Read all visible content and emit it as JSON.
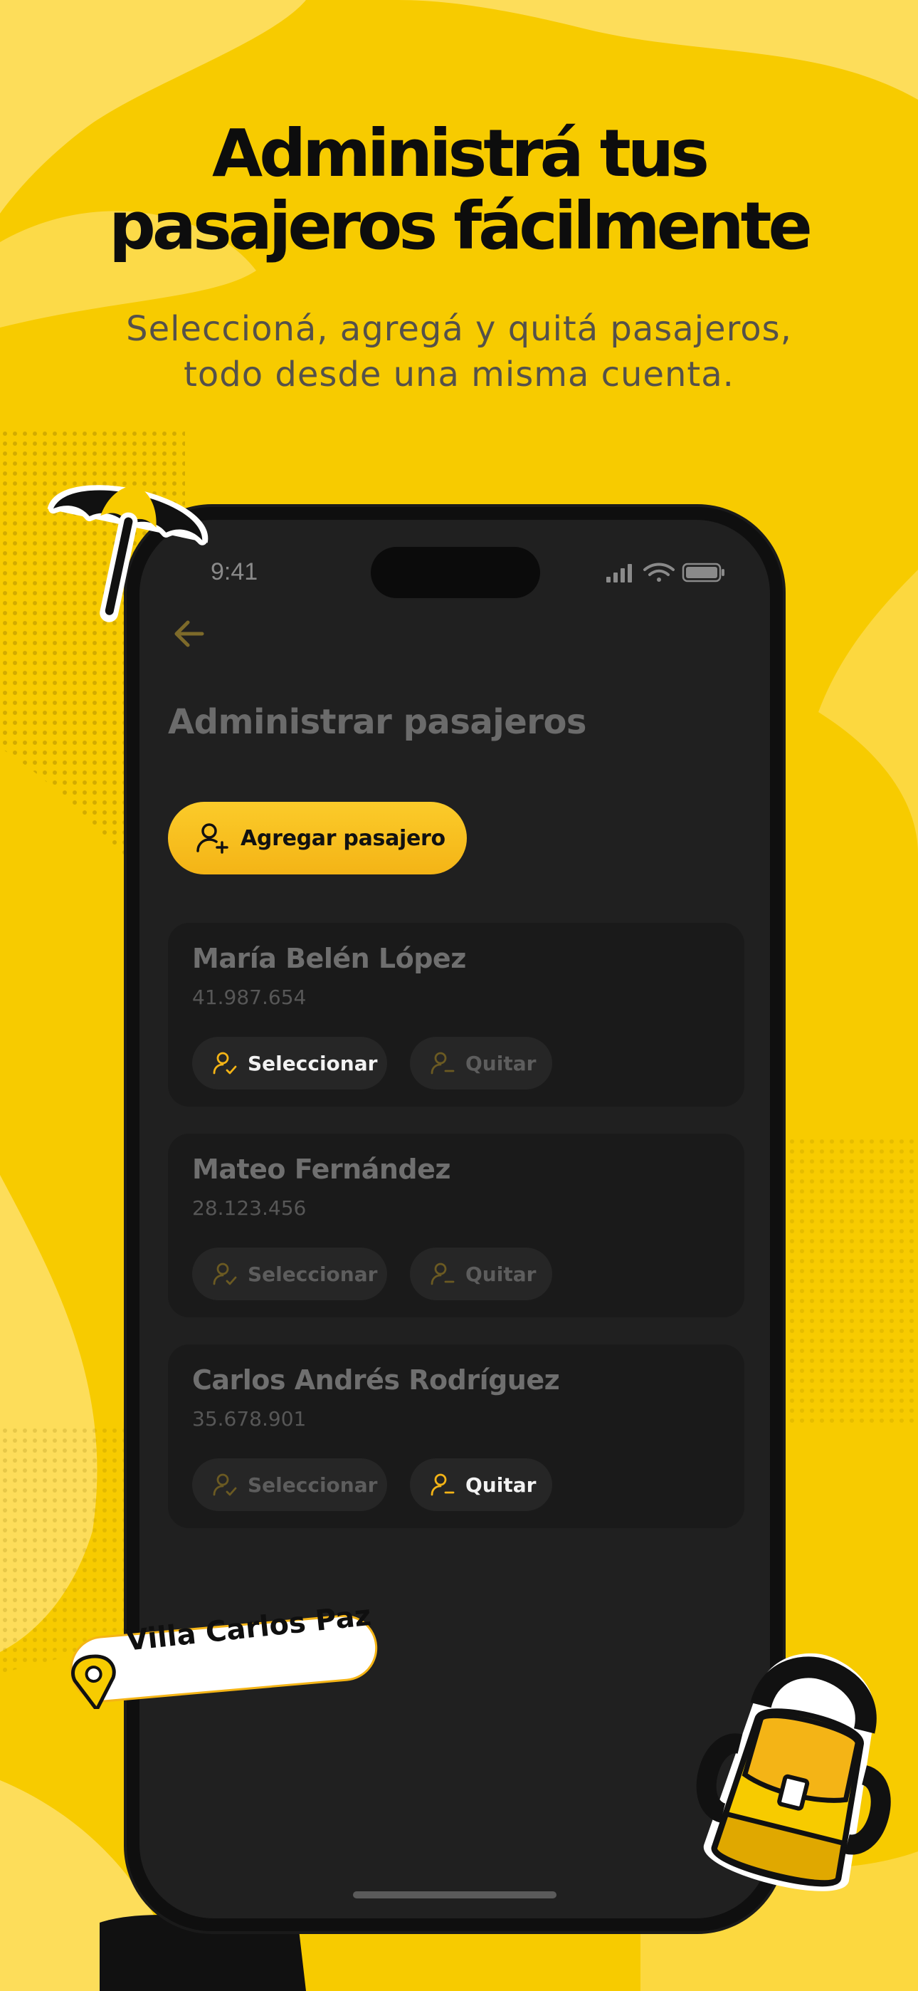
{
  "headline": {
    "line1": "Administrá tus",
    "line2": "pasajeros fácilmente"
  },
  "subheadline": "Seleccioná, agregá y quitá pasajeros, todo desde una misma cuenta.",
  "status_bar": {
    "time": "9:41"
  },
  "screen": {
    "title": "Administrar pasajeros",
    "add_button_label": "Agregar pasajero"
  },
  "passengers": [
    {
      "name": "María Belén López",
      "id_number": "41.987.654",
      "select_label": "Seleccionar",
      "remove_label": "Quitar",
      "active_action": "select"
    },
    {
      "name": "Mateo Fernández",
      "id_number": "28.123.456",
      "select_label": "Seleccionar",
      "remove_label": "Quitar",
      "active_action": "none"
    },
    {
      "name": "Carlos Andrés Rodríguez",
      "id_number": "35.678.901",
      "select_label": "Seleccionar",
      "remove_label": "Quitar",
      "active_action": "remove"
    }
  ],
  "location_badge": "Villa Carlos Paz",
  "colors": {
    "background": "#F7CB00",
    "accent": "#F4B416",
    "screen": "#202020",
    "card": "#1a1a1a"
  },
  "icons": [
    "back-arrow-icon",
    "add-user-icon",
    "user-check-icon",
    "user-minus-icon",
    "signal-icon",
    "wifi-icon",
    "battery-icon",
    "location-pin-icon",
    "umbrella-icon",
    "backpack-icon"
  ]
}
